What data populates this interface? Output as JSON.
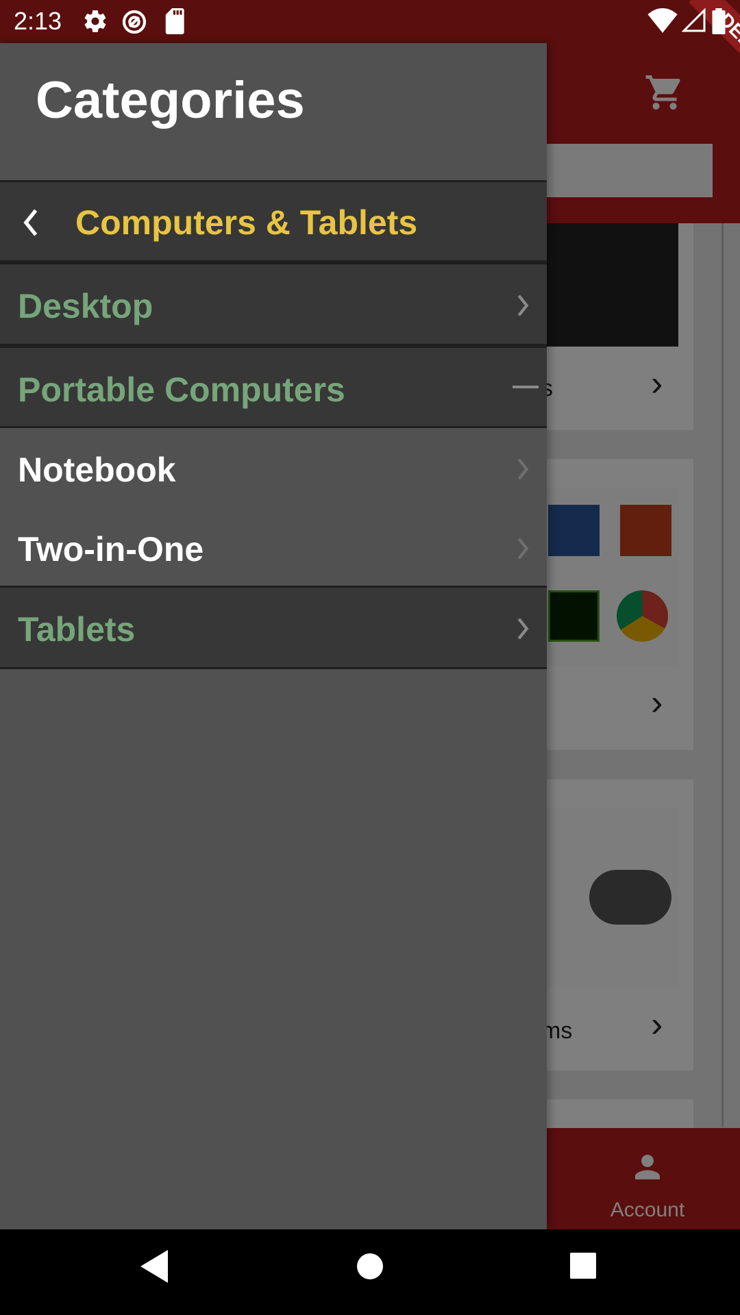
{
  "status_bar": {
    "time": "2:13",
    "icons": [
      "gear-icon",
      "sync-icon",
      "sd-card-icon",
      "wifi-icon",
      "signal-icon",
      "battery-icon"
    ]
  },
  "debug_banner": "DEBUG",
  "background_app": {
    "cards": [
      {
        "text_fragment": "s"
      },
      {
        "text_fragment": ""
      },
      {
        "text_fragment": "ms"
      }
    ],
    "bottom_nav": {
      "account_label": "Account"
    }
  },
  "drawer": {
    "title": "Categories",
    "back_row": {
      "label": "Computers & Tablets"
    },
    "items": [
      {
        "label": "Desktop",
        "style": "category",
        "icon": "chevron-right-icon"
      },
      {
        "label": "Portable Computers",
        "style": "category",
        "icon": "collapse-icon"
      },
      {
        "label": "Notebook",
        "style": "subcategory",
        "icon": "chevron-right-icon"
      },
      {
        "label": "Two-in-One",
        "style": "subcategory",
        "icon": "chevron-right-icon"
      },
      {
        "label": "Tablets",
        "style": "category",
        "icon": "chevron-right-icon"
      }
    ]
  },
  "colors": {
    "drawer_bg": "#515151",
    "row_dark_bg": "#373737",
    "category_text": "#76a57a",
    "back_row_text": "#e8c443",
    "appbar": "#b71c1c"
  }
}
